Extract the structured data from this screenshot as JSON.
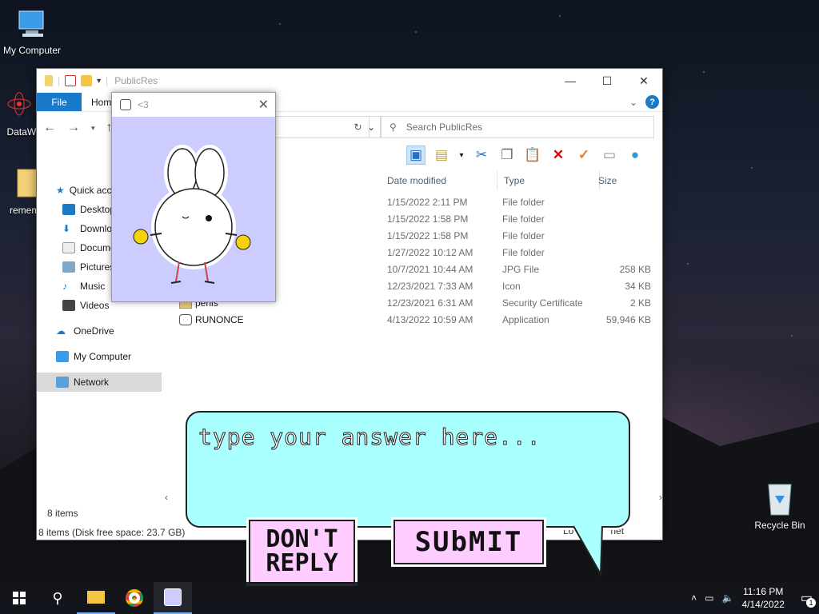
{
  "desktop": {
    "icons": [
      {
        "label": "My Computer"
      },
      {
        "label": "DataWa"
      },
      {
        "label": "rememb"
      },
      {
        "label": "Recycle Bin"
      }
    ]
  },
  "explorer": {
    "title": "PublicRes",
    "tabs": {
      "file": "File",
      "home": "Hom"
    },
    "address": "s",
    "search_placeholder": "Search PublicRes",
    "sidebar": {
      "quick_access": "Quick acc",
      "items": [
        "Desktop",
        "Downlo",
        "Docume",
        "Pictures",
        "Music",
        "Videos"
      ],
      "onedrive": "OneDrive",
      "my_computer": "My Computer",
      "network": "Network"
    },
    "columns": {
      "date": "Date modified",
      "type": "Type",
      "size": "Size"
    },
    "rows": [
      {
        "name": "",
        "date": "1/15/2022 2:11 PM",
        "type": "File folder",
        "size": ""
      },
      {
        "name": "",
        "date": "1/15/2022 1:58 PM",
        "type": "File folder",
        "size": ""
      },
      {
        "name": "",
        "date": "1/15/2022 1:58 PM",
        "type": "File folder",
        "size": ""
      },
      {
        "name": "",
        "date": "1/27/2022 10:12 AM",
        "type": "File folder",
        "size": ""
      },
      {
        "name": "",
        "date": "10/7/2021 10:44 AM",
        "type": "JPG File",
        "size": "258 KB"
      },
      {
        "name": "",
        "date": "12/23/2021 7:33 AM",
        "type": "Icon",
        "size": "34 KB"
      },
      {
        "name": "penis",
        "date": "12/23/2021 6:31 AM",
        "type": "Security Certificate",
        "size": "2 KB"
      },
      {
        "name": "RUNONCE",
        "date": "4/13/2022 10:59 AM",
        "type": "Application",
        "size": "59,946 KB"
      }
    ],
    "item_count": "8 items",
    "status": "8 items (Disk free space: 23.7 GB)",
    "status_tail_lo": "Lo",
    "status_tail_net": "net"
  },
  "popup": {
    "title": "<3"
  },
  "dialog": {
    "placeholder": "type your answer here...",
    "dont_reply_line1": "DON'T",
    "dont_reply_line2": "REPLY",
    "submit": "SUbMIT"
  },
  "taskbar": {
    "time": "11:16 PM",
    "date": "4/14/2022",
    "notification_count": "1"
  },
  "colors": {
    "accent": "#1979ca",
    "bubble": "#aaffff",
    "button": "#ffccff",
    "popup_bg": "#ccccff"
  }
}
